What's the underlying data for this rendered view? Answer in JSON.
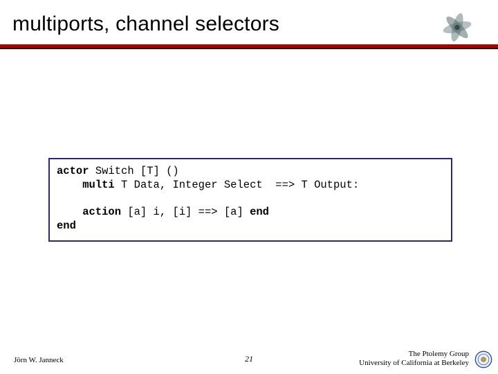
{
  "title": "multiports, channel selectors",
  "code": {
    "line1_kw1": "actor",
    "line1_rest": " Switch [T] ()",
    "line2_indent": "    ",
    "line2_kw": "multi",
    "line2_rest": " T Data, Integer Select  ==> T Output:",
    "blank": "",
    "line3_indent": "    ",
    "line3_kw": "action",
    "line3_rest": " [a] i, [i] ==> [a] ",
    "line3_kw2": "end",
    "line4_kw": "end"
  },
  "footer": {
    "left": "Jörn W. Janneck",
    "page": "21",
    "group": "The Ptolemy Group",
    "affil": "University of California at Berkeley"
  }
}
